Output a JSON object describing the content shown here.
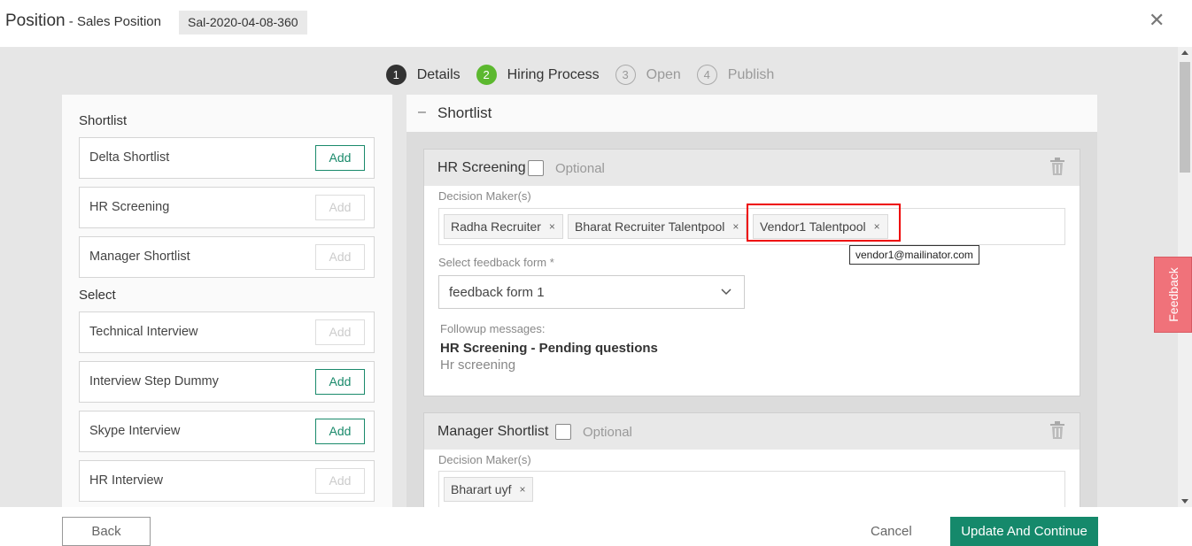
{
  "header": {
    "title": "Position",
    "subtitle": " - Sales Position",
    "code": "Sal-2020-04-08-360"
  },
  "stepper": [
    {
      "num": "1",
      "label": "Details",
      "state": "done"
    },
    {
      "num": "2",
      "label": "Hiring Process",
      "state": "active"
    },
    {
      "num": "3",
      "label": "Open",
      "state": "pending"
    },
    {
      "num": "4",
      "label": "Publish",
      "state": "pending"
    }
  ],
  "left_panel": {
    "shortlist_label": "Shortlist",
    "select_label": "Select",
    "shortlist_items": [
      {
        "label": "Delta Shortlist",
        "add": "Add",
        "enabled": true
      },
      {
        "label": "HR Screening",
        "add": "Add",
        "enabled": false
      },
      {
        "label": "Manager Shortlist",
        "add": "Add",
        "enabled": false
      }
    ],
    "select_items": [
      {
        "label": "Technical Interview",
        "add": "Add",
        "enabled": false
      },
      {
        "label": "Interview Step Dummy",
        "add": "Add",
        "enabled": true
      },
      {
        "label": "Skype Interview",
        "add": "Add",
        "enabled": true
      },
      {
        "label": "HR Interview",
        "add": "Add",
        "enabled": false
      }
    ]
  },
  "right_panel": {
    "section_dash": "–",
    "section_title": "Shortlist",
    "cards": [
      {
        "name": "HR Screening",
        "optional": "Optional",
        "dm_label": "Decision Maker(s)",
        "tags": [
          "Radha Recruiter",
          "Bharat Recruiter Talentpool",
          "Vendor1 Talentpool"
        ],
        "tooltip": "vendor1@mailinator.com",
        "ff_label": "Select feedback form *",
        "ff_value": "feedback form 1",
        "fu_label": "Followup messages:",
        "fu_title": "HR Screening - Pending questions",
        "fu_sub": "Hr screening"
      },
      {
        "name": "Manager Shortlist",
        "optional": "Optional",
        "dm_label": "Decision Maker(s)",
        "tags": [
          "Bharart uyf"
        ]
      }
    ]
  },
  "tag_remove_glyph": "×",
  "close_glyph": "✕",
  "feedback_label": "Feedback",
  "footer": {
    "back": "Back",
    "cancel": "Cancel",
    "update": "Update And Continue"
  },
  "colors": {
    "accent_green": "#15896b",
    "step_active": "#5cb82f",
    "highlight": "#e00000",
    "feedback_tab": "#f0727a"
  }
}
